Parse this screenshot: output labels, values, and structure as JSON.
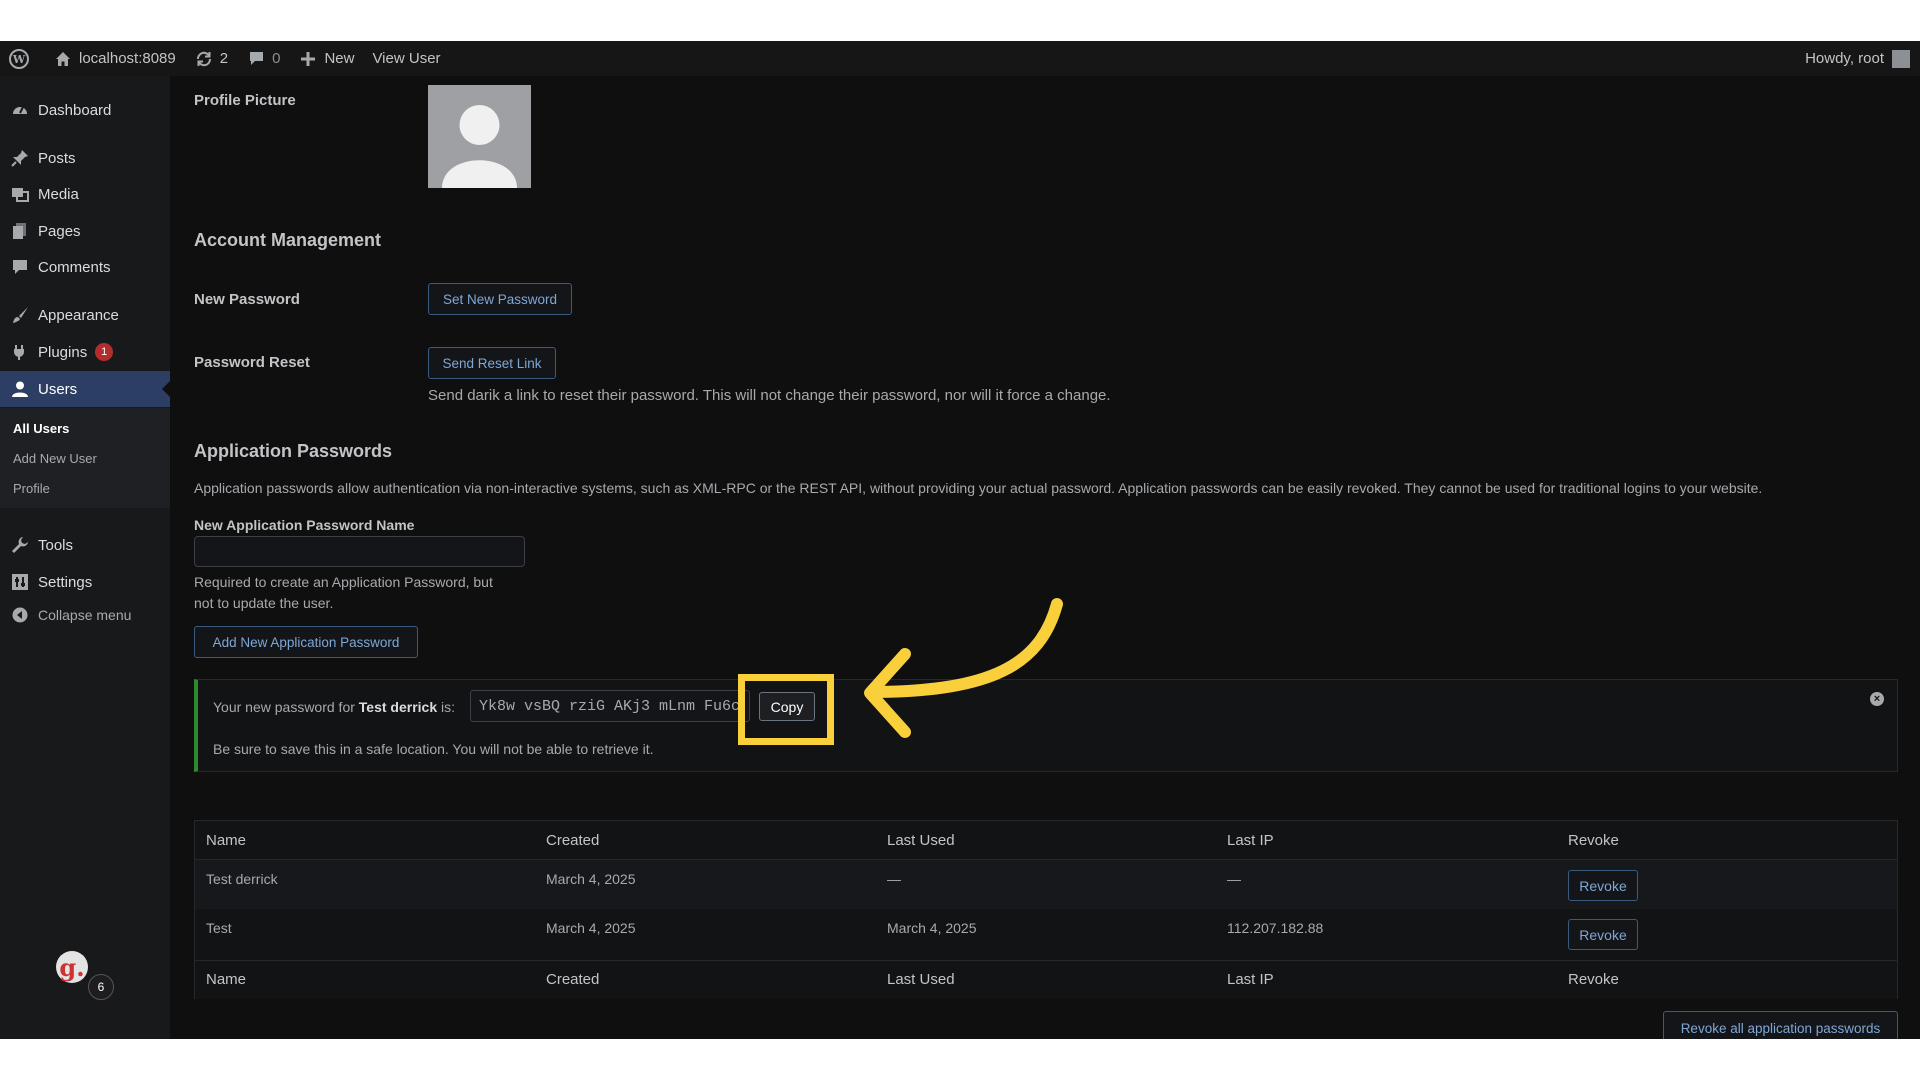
{
  "admin_bar": {
    "site_name": "localhost:8089",
    "updates_count": "2",
    "comments_count": "0",
    "new_label": "New",
    "view_user_label": "View User",
    "greeting": "Howdy, root"
  },
  "sidebar": {
    "items": [
      {
        "label": "Dashboard",
        "icon": "dashboard-icon"
      },
      {
        "label": "Posts",
        "icon": "pin-icon"
      },
      {
        "label": "Media",
        "icon": "media-icon"
      },
      {
        "label": "Pages",
        "icon": "pages-icon"
      },
      {
        "label": "Comments",
        "icon": "comment-icon"
      },
      {
        "label": "Appearance",
        "icon": "brush-icon"
      },
      {
        "label": "Plugins",
        "icon": "plugin-icon",
        "badge": "1"
      },
      {
        "label": "Users",
        "icon": "user-icon"
      },
      {
        "label": "Tools",
        "icon": "wrench-icon"
      },
      {
        "label": "Settings",
        "icon": "settings-icon"
      }
    ],
    "submenu": [
      "All Users",
      "Add New User",
      "Profile"
    ],
    "collapse_label": "Collapse menu",
    "grav_badge": "6"
  },
  "profile": {
    "picture_label": "Profile Picture"
  },
  "account": {
    "heading": "Account Management",
    "new_password_label": "New Password",
    "set_new_password_button": "Set New Password",
    "password_reset_label": "Password Reset",
    "send_reset_link_button": "Send Reset Link",
    "reset_description": "Send darik a link to reset their password. This will not change their password, nor will it force a change."
  },
  "app_passwords": {
    "heading": "Application Passwords",
    "description": "Application passwords allow authentication via non-interactive systems, such as XML-RPC or the REST API, without providing your actual password. Application passwords can be easily revoked. They cannot be used for traditional logins to your website.",
    "name_label": "New Application Password Name",
    "name_value": "",
    "name_help_1": "Required to create an Application Password, but",
    "name_help_2": "not to update the user.",
    "add_button": "Add New Application Password",
    "notice": {
      "prefix": "Your new password for",
      "app_name": "Test derrick",
      "suffix": "is:",
      "password": "Yk8w vsBQ rziG AKj3 mLnm Fu6c",
      "copy_button": "Copy",
      "warning": "Be sure to save this in a safe location. You will not be able to retrieve it."
    },
    "table": {
      "columns": [
        "Name",
        "Created",
        "Last Used",
        "Last IP",
        "Revoke"
      ],
      "rows": [
        {
          "name": "Test derrick",
          "created": "March 4, 2025",
          "last_used": "—",
          "last_ip": "—",
          "revoke": "Revoke"
        },
        {
          "name": "Test",
          "created": "March 4, 2025",
          "last_used": "March 4, 2025",
          "last_ip": "112.207.182.88",
          "revoke": "Revoke"
        }
      ]
    },
    "revoke_all_button": "Revoke all application passwords"
  },
  "colors": {
    "highlight": "#f9cf3b",
    "active_menu": "#2c3e63",
    "notice_border": "#2f8a2f"
  }
}
